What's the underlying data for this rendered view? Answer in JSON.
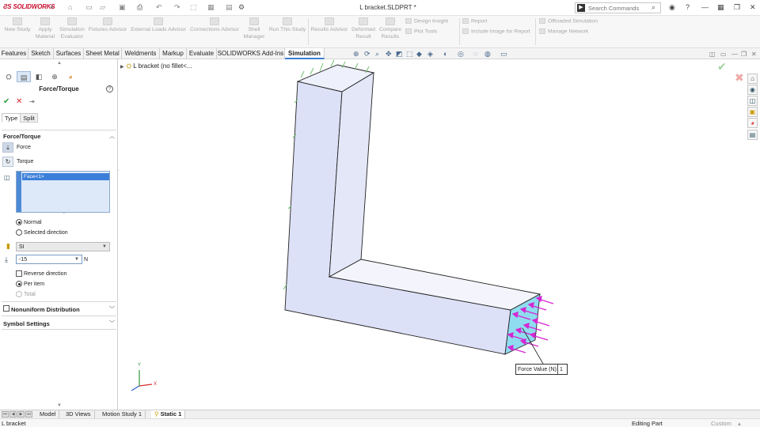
{
  "titlebar": {
    "logo_text": "SOLIDWORKS",
    "doc_title": "L bracket.SLDPRT *",
    "search_placeholder": "Search Commands"
  },
  "ribbon": {
    "commands": [
      {
        "label": "New Study"
      },
      {
        "label": "Apply Material"
      },
      {
        "label": "Simulation Evaluator"
      },
      {
        "label": "Fixtures Advisor"
      },
      {
        "label": "External Loads Advisor"
      },
      {
        "label": "Connections Advisor"
      },
      {
        "label": "Shell Manager"
      },
      {
        "label": "Run This Study"
      },
      {
        "label": "Results Advisor"
      },
      {
        "label": "Deformed Result"
      },
      {
        "label": "Compare Results"
      }
    ],
    "small": {
      "design_insight": "Design Insight",
      "plot_tools": "Plot Tools",
      "report": "Report",
      "include_image": "Include Image for Report",
      "offloaded": "Offloaded Simulation",
      "manage_network": "Manage Network"
    }
  },
  "tabs": [
    "Features",
    "Sketch",
    "Surfaces",
    "Sheet Metal",
    "Weldments",
    "Markup",
    "Evaluate",
    "SOLIDWORKS Add-Ins",
    "Simulation"
  ],
  "active_tab": "Simulation",
  "panel": {
    "title": "Force/Torque",
    "subtabs": [
      "Type",
      "Split"
    ],
    "section_force_torque": "Force/Torque",
    "force_label": "Force",
    "torque_label": "Torque",
    "selected_item": "Face<1>",
    "normal_label": "Normal",
    "selected_direction_label": "Selected direction",
    "units_value": "SI",
    "force_value": "-15",
    "unit_label": "N",
    "reverse_label": "Reverse direction",
    "per_item_label": "Per item",
    "total_label": "Total",
    "nonuniform_label": "Nonuniform Distribution",
    "symbol_settings_label": "Symbol Settings"
  },
  "viewport": {
    "tree_label": "L bracket  (no fillet<...",
    "callout_label": "Force Value (N):",
    "callout_value": "1",
    "triad_y": "Y",
    "triad_x": "X",
    "colors": {
      "part_face": "#dde1f7",
      "load_face": "#8fdcf0",
      "force_arrow": "#d626d2",
      "fixture": "#6fc06f"
    }
  },
  "bottom_tabs": [
    "Model",
    "3D Views",
    "Motion Study 1",
    "Static 1"
  ],
  "active_bottom_tab": "Static 1",
  "status": {
    "left": "L bracket",
    "mid": "Editing Part",
    "right": "Custom"
  }
}
